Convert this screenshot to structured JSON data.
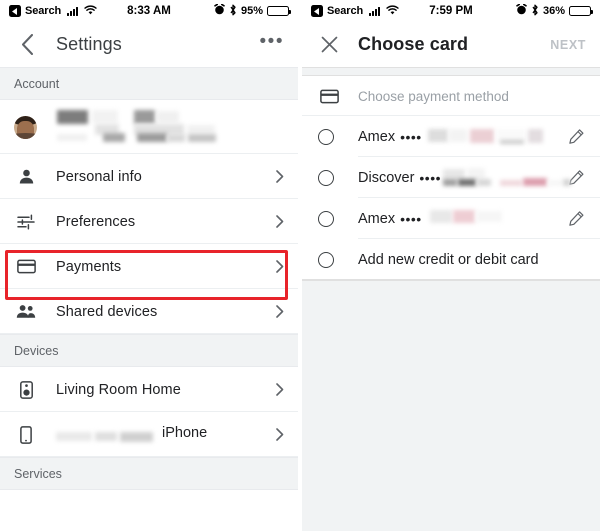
{
  "left": {
    "status": {
      "back_badge": "◀",
      "carrier_label": "Search",
      "time": "8:33 AM",
      "battery_pct": "95%",
      "alarm_icon": "alarm-icon",
      "bluetooth_icon": "bluetooth-icon",
      "wifi_icon": "wifi-icon",
      "signal_icon": "cellular-signal-icon"
    },
    "nav": {
      "back_icon": "back-chevron-icon",
      "title": "Settings",
      "overflow": "•••"
    },
    "sections": [
      {
        "header": "Account"
      },
      {
        "header": "Devices"
      },
      {
        "header": "Services"
      }
    ],
    "account_header": "Account",
    "devices_header": "Devices",
    "services_header": "Services",
    "items": [
      {
        "label": "Personal info",
        "icon": "person-icon"
      },
      {
        "label": "Preferences",
        "icon": "sliders-icon"
      },
      {
        "label": "Payments",
        "icon": "credit-card-icon"
      },
      {
        "label": "Shared devices",
        "icon": "people-icon"
      },
      {
        "label": "Living Room Home",
        "icon": "speaker-icon"
      },
      {
        "label": "iPhone",
        "icon": "phone-icon"
      }
    ],
    "highlight_color": "#e8232a"
  },
  "right": {
    "status": {
      "back_badge": "◀",
      "carrier_label": "Search",
      "time": "7:59 PM",
      "battery_pct": "36%",
      "alarm_icon": "alarm-icon",
      "bluetooth_icon": "bluetooth-icon",
      "wifi_icon": "wifi-icon",
      "signal_icon": "cellular-signal-icon"
    },
    "nav": {
      "close_icon": "close-icon",
      "title": "Choose card",
      "next_label": "NEXT"
    },
    "payment_method_header": "Choose payment method",
    "cards": [
      {
        "brand": "Amex",
        "dots": "••••",
        "edit_icon": "pencil-icon"
      },
      {
        "brand": "Discover",
        "dots": "••••",
        "edit_icon": "pencil-icon"
      },
      {
        "brand": "Amex",
        "dots": "••••",
        "edit_icon": "pencil-icon"
      }
    ],
    "add_card_label": "Add new credit or debit card"
  }
}
